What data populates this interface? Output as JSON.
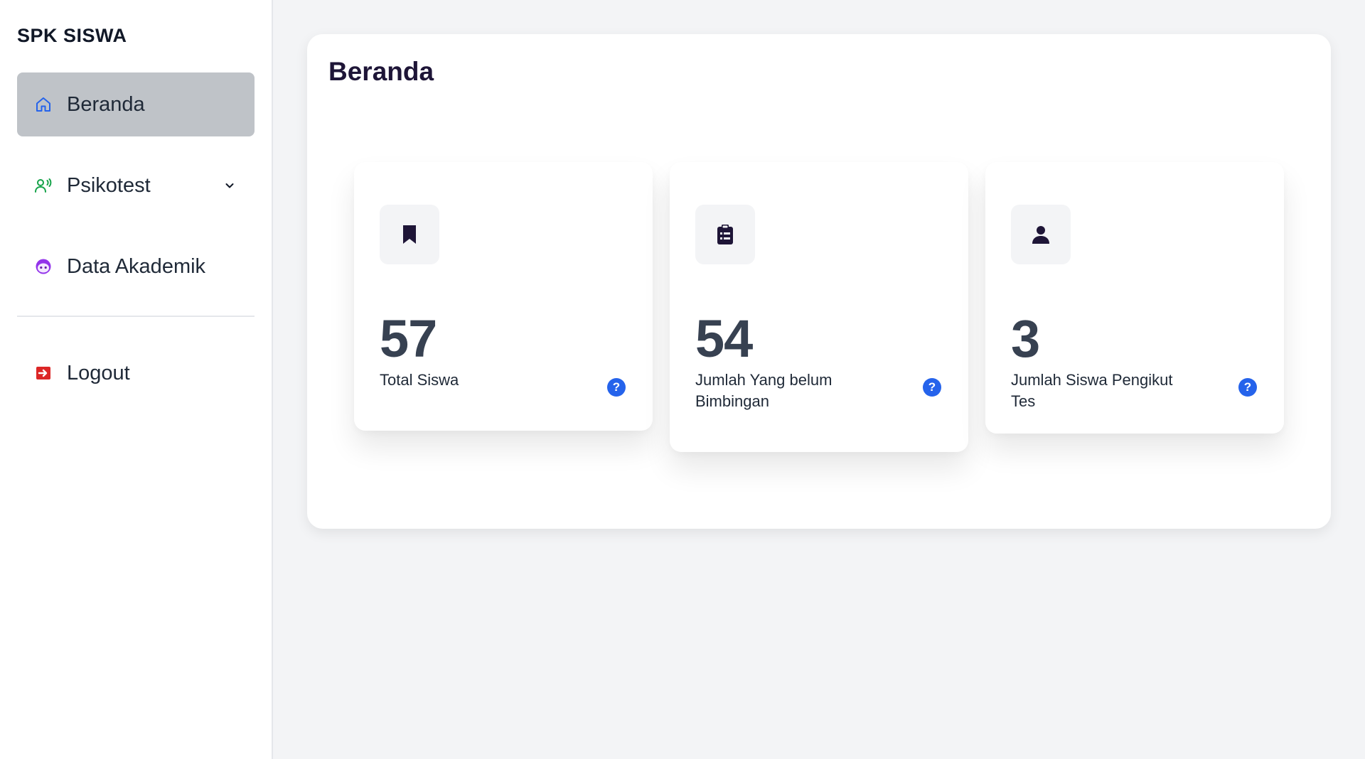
{
  "sidebar": {
    "brand": "SPK SISWA",
    "items": [
      {
        "label": "Beranda",
        "icon": "home-icon",
        "active": true,
        "color": "#2563eb"
      },
      {
        "label": "Psikotest",
        "icon": "user-voice-icon",
        "active": false,
        "color": "#16a34a",
        "has_submenu": true
      },
      {
        "label": "Data Akademik",
        "icon": "face-icon",
        "active": false,
        "color": "#9333ea"
      }
    ],
    "logout": {
      "label": "Logout",
      "icon": "logout-icon",
      "color": "#dc2626"
    }
  },
  "main": {
    "title": "Beranda",
    "cards": [
      {
        "value": "57",
        "label": "Total Siswa",
        "icon": "bookmark-icon",
        "help": "?"
      },
      {
        "value": "54",
        "label": "Jumlah Yang belum Bimbingan",
        "icon": "clipboard-list-icon",
        "help": "?"
      },
      {
        "value": "3",
        "label": "Jumlah Siswa Pengikut Tes",
        "icon": "user-icon",
        "help": "?"
      }
    ]
  },
  "colors": {
    "accent": "#2563eb",
    "active_nav_bg": "#bfc3c8",
    "icon_dark": "#1e1537"
  }
}
